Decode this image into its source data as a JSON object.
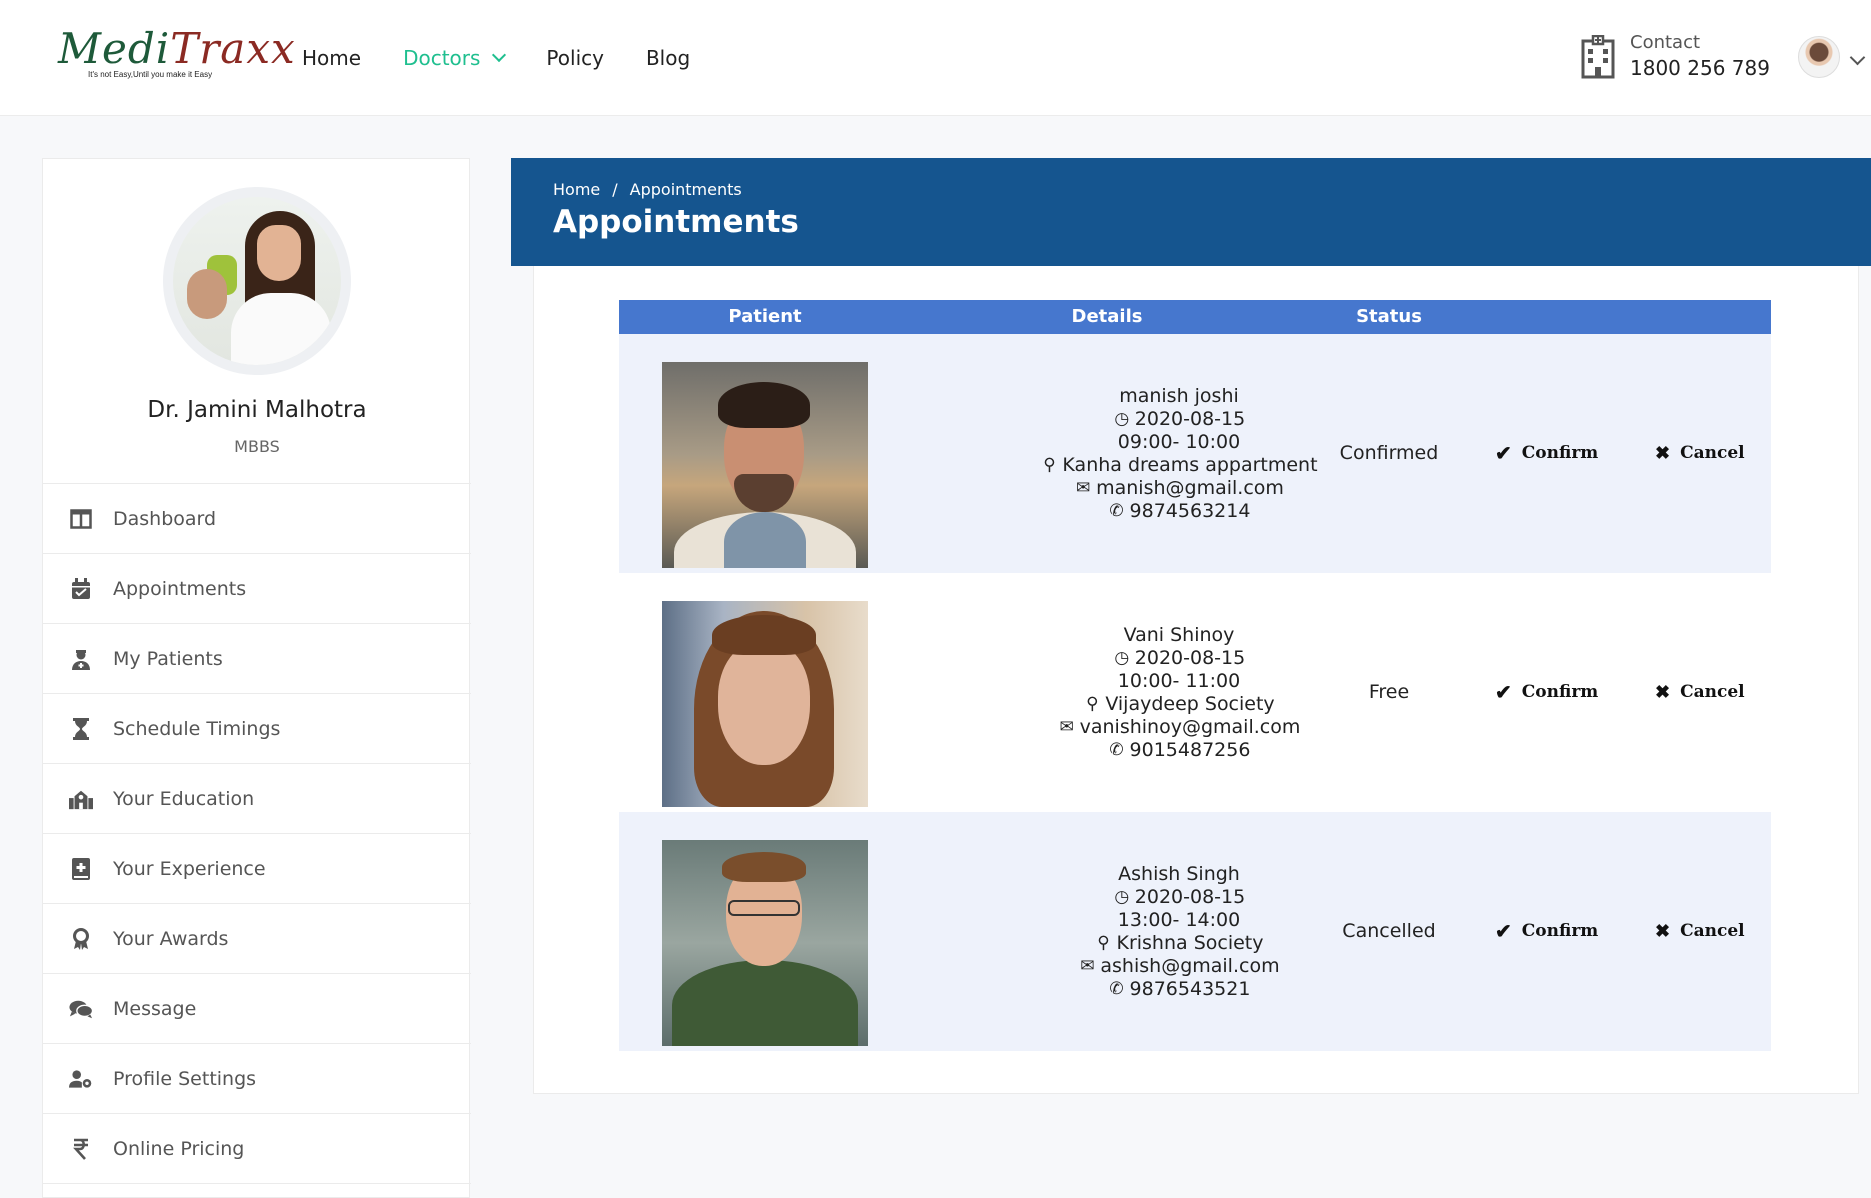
{
  "brand": {
    "name_part1": "Medi",
    "name_part2": "Traxx",
    "tagline": "It's not Easy,Until you make it Easy"
  },
  "nav": {
    "items": [
      {
        "label": "Home"
      },
      {
        "label": "Doctors",
        "active": true
      },
      {
        "label": "Policy"
      },
      {
        "label": "Blog"
      }
    ]
  },
  "contact": {
    "label": "Contact",
    "phone": "1800 256 789"
  },
  "profile": {
    "name": "Dr. Jamini Malhotra",
    "degree": "MBBS"
  },
  "menu": [
    {
      "label": "Dashboard",
      "icon": "columns-icon"
    },
    {
      "label": "Appointments",
      "icon": "calendar-check-icon"
    },
    {
      "label": "My Patients",
      "icon": "user-nurse-icon"
    },
    {
      "label": "Schedule Timings",
      "icon": "hourglass-icon"
    },
    {
      "label": "Your Education",
      "icon": "school-icon"
    },
    {
      "label": "Your Experience",
      "icon": "medical-book-icon"
    },
    {
      "label": "Your Awards",
      "icon": "award-icon"
    },
    {
      "label": "Message",
      "icon": "comments-icon"
    },
    {
      "label": "Profile Settings",
      "icon": "user-cog-icon"
    },
    {
      "label": "Online Pricing",
      "icon": "rupee-icon"
    }
  ],
  "banner": {
    "breadcrumb_home": "Home",
    "breadcrumb_sep": "/",
    "breadcrumb_current": "Appointments",
    "title": "Appointments"
  },
  "table": {
    "headers": {
      "patient": "Patient",
      "details": "Details",
      "status": "Status"
    },
    "rows": [
      {
        "name": "manish joshi",
        "date": "2020-08-15",
        "time": "09:00- 10:00",
        "address": "Kanha dreams appartment",
        "email": "manish@gmail.com",
        "phone": "9874563214",
        "status": "Confirmed",
        "confirm_label": "Confirm",
        "cancel_label": "Cancel"
      },
      {
        "name": "Vani Shinoy",
        "date": "2020-08-15",
        "time": "10:00- 11:00",
        "address": "Vijaydeep Society",
        "email": "vanishinoy@gmail.com",
        "phone": "9015487256",
        "status": "Free",
        "confirm_label": "Confirm",
        "cancel_label": "Cancel"
      },
      {
        "name": "Ashish Singh",
        "date": "2020-08-15",
        "time": "13:00- 14:00",
        "address": "Krishna Society",
        "email": "ashish@gmail.com",
        "phone": "9876543521",
        "status": "Cancelled",
        "confirm_label": "Confirm",
        "cancel_label": "Cancel"
      }
    ]
  },
  "colors": {
    "accent": "#1fbf8f",
    "banner": "#15558f",
    "table_header": "#4677ce",
    "row_shade": "#eef2fb"
  }
}
